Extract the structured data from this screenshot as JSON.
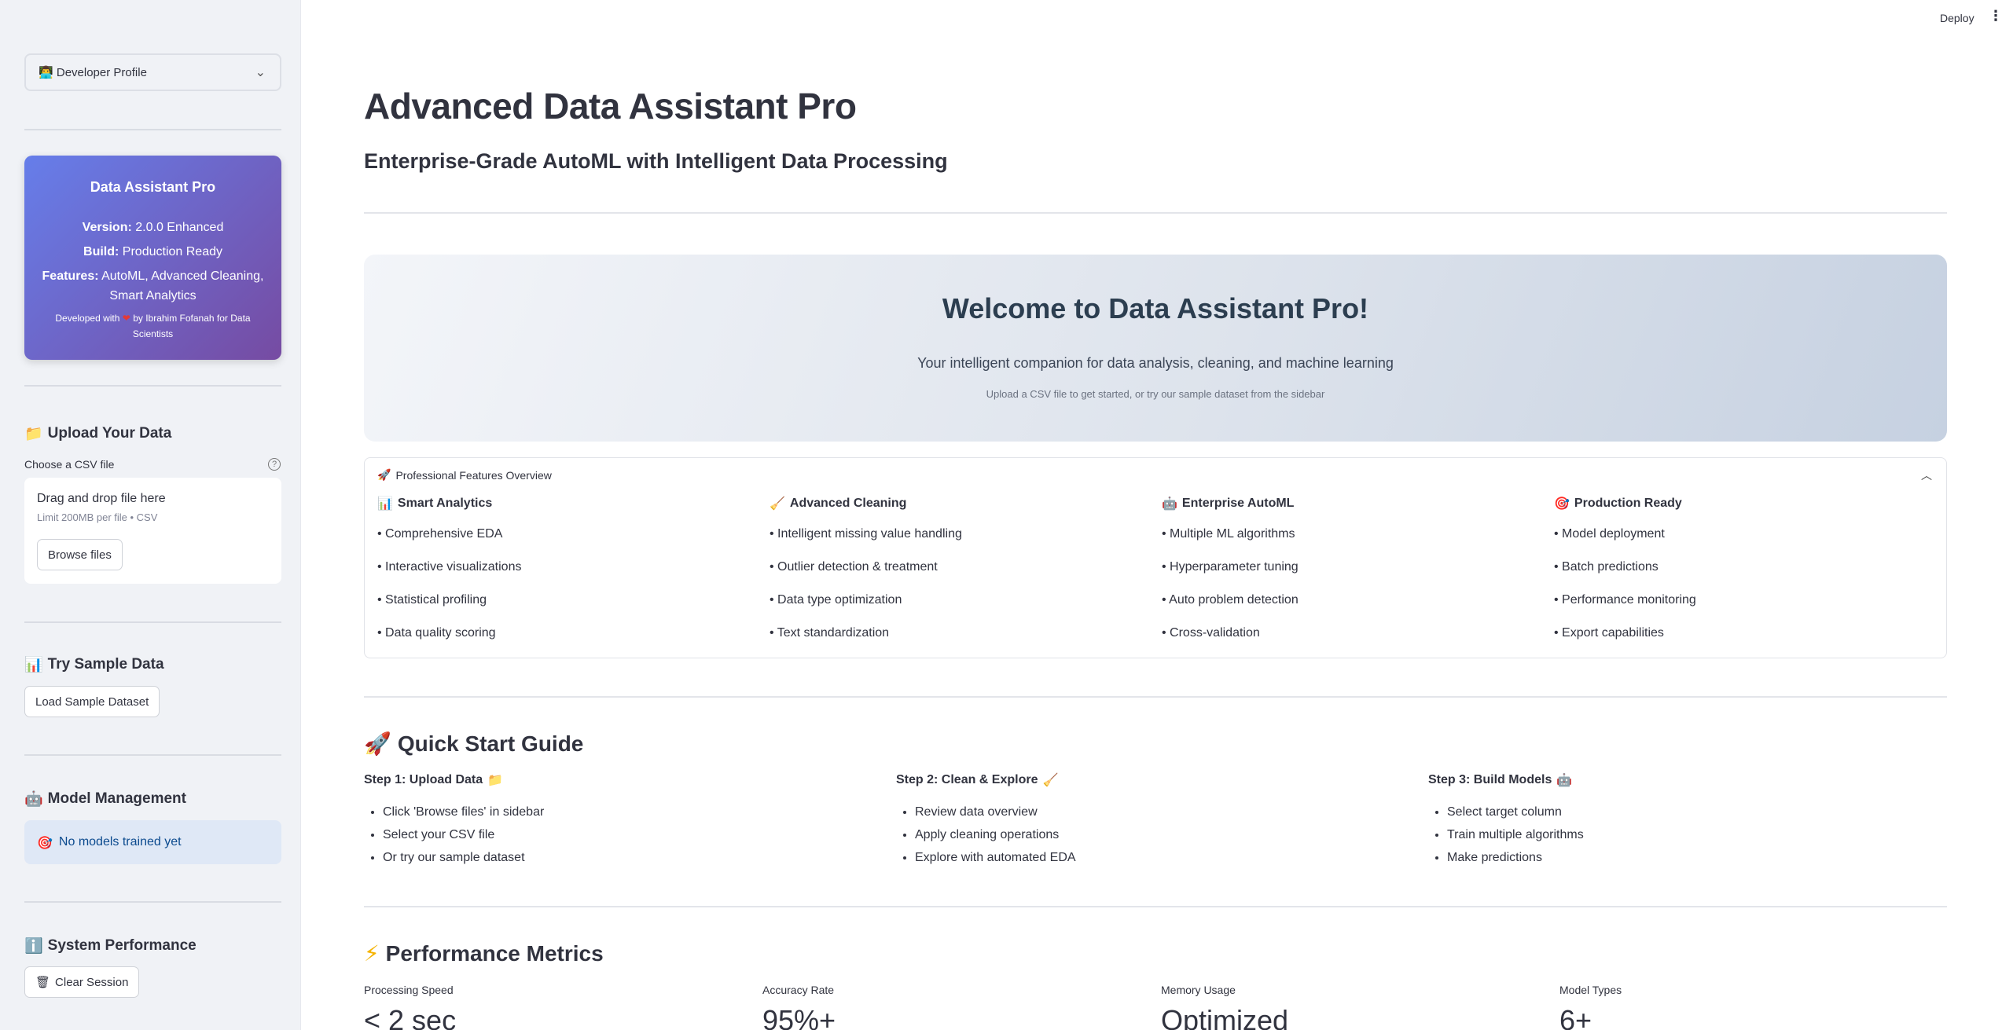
{
  "sidebar": {
    "profile_select": {
      "icon": "developer-icon",
      "label": "Developer Profile"
    },
    "card": {
      "title": "Data Assistant Pro",
      "version_label": "Version:",
      "version_value": "2.0.0 Enhanced",
      "build_label": "Build:",
      "build_value": "Production Ready",
      "features_label": "Features:",
      "features_value": "AutoML, Advanced Cleaning, Smart Analytics",
      "dev_prefix": "Developed with",
      "dev_suffix": "by Ibrahim Fofanah for Data Scientists"
    },
    "upload": {
      "heading": "Upload Your Data",
      "field_label": "Choose a CSV file",
      "drop_title": "Drag and drop file here",
      "drop_limit": "Limit 200MB per file • CSV",
      "browse_label": "Browse files"
    },
    "sample": {
      "heading": "Try Sample Data",
      "button_label": "Load Sample Dataset"
    },
    "models": {
      "heading": "Model Management",
      "info_text": "No models trained yet"
    },
    "system": {
      "heading": "System Performance",
      "button_label": "Clear Session"
    }
  },
  "topbar": {
    "deploy_label": "Deploy"
  },
  "main": {
    "title": "Advanced Data Assistant Pro",
    "subtitle": "Enterprise-Grade AutoML with Intelligent Data Processing",
    "welcome": {
      "title": "Welcome to Data Assistant Pro!",
      "subtitle": "Your intelligent companion for data analysis, cleaning, and machine learning",
      "hint": "Upload a CSV file to get started, or try our sample dataset from the sidebar"
    },
    "features": {
      "header": "Professional Features Overview",
      "columns": [
        {
          "title": "Smart Analytics",
          "items": [
            "• Comprehensive EDA",
            "• Interactive visualizations",
            "• Statistical profiling",
            "• Data quality scoring"
          ]
        },
        {
          "title": "Advanced Cleaning",
          "items": [
            "• Intelligent missing value handling",
            "• Outlier detection & treatment",
            "• Data type optimization",
            "• Text standardization"
          ]
        },
        {
          "title": "Enterprise AutoML",
          "items": [
            "• Multiple ML algorithms",
            "• Hyperparameter tuning",
            "• Auto problem detection",
            "• Cross-validation"
          ]
        },
        {
          "title": "Production Ready",
          "items": [
            "• Model deployment",
            "• Batch predictions",
            "• Performance monitoring",
            "• Export capabilities"
          ]
        }
      ]
    },
    "quick_start": {
      "heading": "Quick Start Guide",
      "steps": [
        {
          "title": "Step 1: Upload Data",
          "items": [
            "Click 'Browse files' in sidebar",
            "Select your CSV file",
            "Or try our sample dataset"
          ]
        },
        {
          "title": "Step 2: Clean & Explore",
          "items": [
            "Review data overview",
            "Apply cleaning operations",
            "Explore with automated EDA"
          ]
        },
        {
          "title": "Step 3: Build Models",
          "items": [
            "Select target column",
            "Train multiple algorithms",
            "Make predictions"
          ]
        }
      ]
    },
    "performance": {
      "heading": "Performance Metrics",
      "metrics": [
        {
          "label": "Processing Speed",
          "value": "< 2 sec"
        },
        {
          "label": "Accuracy Rate",
          "value": "95%+"
        },
        {
          "label": "Memory Usage",
          "value": "Optimized"
        },
        {
          "label": "Model Types",
          "value": "6+"
        }
      ]
    }
  }
}
